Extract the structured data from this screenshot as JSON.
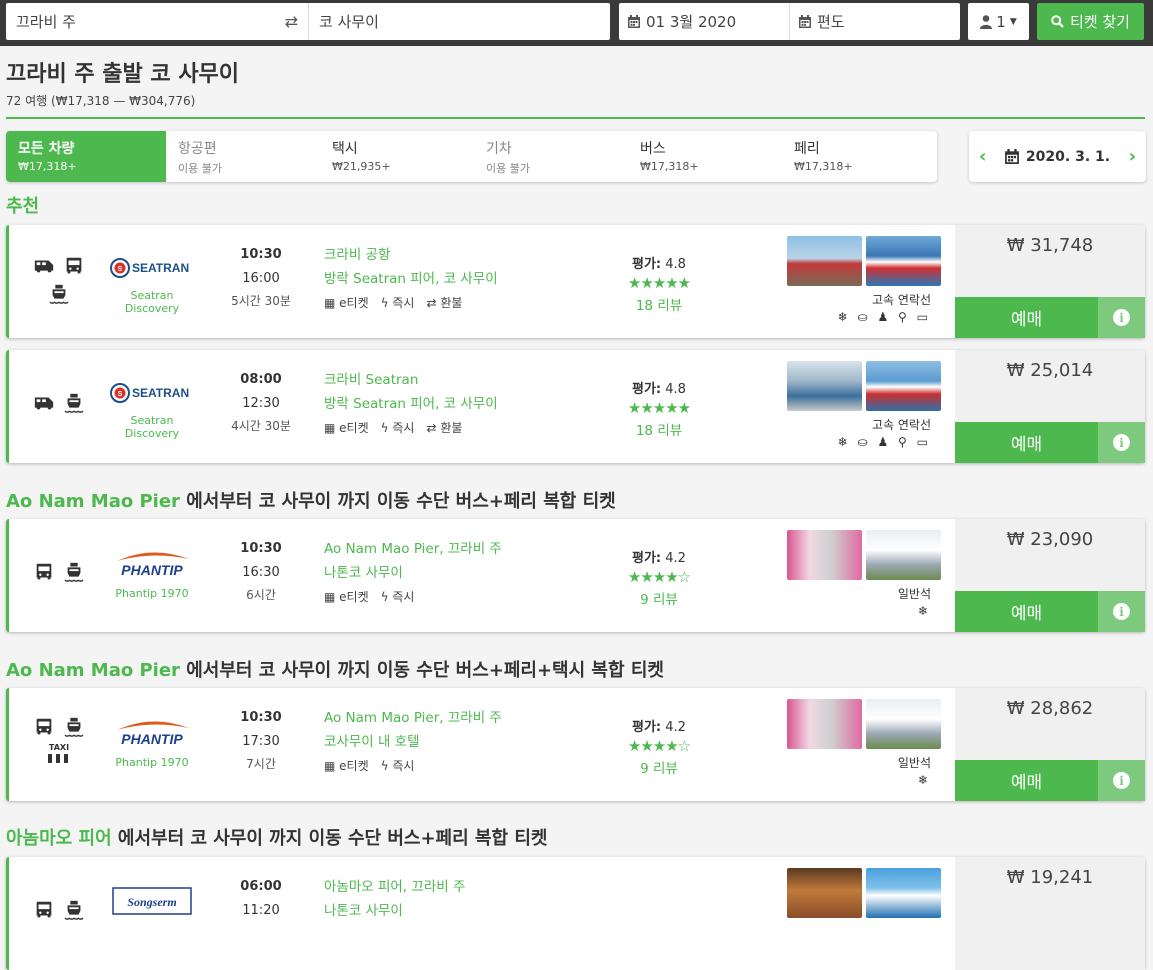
{
  "search": {
    "from": "끄라비 주",
    "to": "코 사무이",
    "date": "01 3월 2020",
    "return": "편도",
    "passengers": "1",
    "search_button": "티켓 찾기"
  },
  "header": {
    "title": "끄라비 주 출발 코 사무이",
    "subtitle": "72 여행 (₩17,318 — ₩304,776)"
  },
  "tabs": [
    {
      "label": "모든 차량",
      "sub": "₩17,318+"
    },
    {
      "label": "항공편",
      "sub": "이용 불가"
    },
    {
      "label": "택시",
      "sub": "₩21,935+"
    },
    {
      "label": "기차",
      "sub": "이용 불가"
    },
    {
      "label": "버스",
      "sub": "₩17,318+"
    },
    {
      "label": "페리",
      "sub": "₩17,318+"
    }
  ],
  "date_nav": {
    "date": "2020. 3. 1."
  },
  "sections": {
    "recommended": "추천",
    "s2_green": "Ao Nam Mao Pier",
    "s2_rest": " 에서부터 코 사무이 까지 이동 수단 버스+페리 복합 티켓",
    "s3_green": "Ao Nam Mao Pier",
    "s3_rest": " 에서부터 코 사무이 까지 이동 수단 버스+페리+택시 복합 티켓",
    "s4_green": "아놈마오 피어",
    "s4_rest": " 에서부터 코 사무이 까지 이동 수단 버스+페리 복합 티켓"
  },
  "labels": {
    "rating": "평가:",
    "book": "예매",
    "eticket": "e티켓",
    "instant": "즉시",
    "refund": "환불",
    "taxi": "TAXI"
  },
  "cards": [
    {
      "company": "Seatran Discovery",
      "logo": "SEATRAN",
      "dep": "10:30",
      "arr": "16:00",
      "dur": "5시간 30분",
      "from": "크라비 공항",
      "to": "방락 Seatran 피어, 코 사무이",
      "score": "4.8",
      "stars": "★★★★★",
      "reviews": "18 리뷰",
      "type": "고속 연락선",
      "amenities": "❄ ⛀ ♟ ⚲ ▭",
      "price": "₩ 31,748"
    },
    {
      "company": "Seatran Discovery",
      "logo": "SEATRAN",
      "dep": "08:00",
      "arr": "12:30",
      "dur": "4시간 30분",
      "from": "크라비 Seatran",
      "to": "방락 Seatran 피어, 코 사무이",
      "score": "4.8",
      "stars": "★★★★★",
      "reviews": "18 리뷰",
      "type": "고속 연락선",
      "amenities": "❄ ⛀ ♟ ⚲ ▭",
      "price": "₩ 25,014"
    },
    {
      "company": "Phantip 1970",
      "logo": "PHANTIP",
      "dep": "10:30",
      "arr": "16:30",
      "dur": "6시간",
      "from": "Ao Nam Mao Pier, 끄라비 주",
      "to": "나톤코 사무이",
      "score": "4.2",
      "stars": "★★★★☆",
      "reviews": "9 리뷰",
      "type": "일반석",
      "amenities": "❄",
      "price": "₩ 23,090"
    },
    {
      "company": "Phantip 1970",
      "logo": "PHANTIP",
      "dep": "10:30",
      "arr": "17:30",
      "dur": "7시간",
      "from": "Ao Nam Mao Pier, 끄라비 주",
      "to": "코사무이 내 호텔",
      "score": "4.2",
      "stars": "★★★★☆",
      "reviews": "9 리뷰",
      "type": "일반석",
      "amenities": "❄",
      "price": "₩ 28,862"
    },
    {
      "company": "Songserm",
      "logo": "Songserm",
      "dep": "06:00",
      "arr": "11:20",
      "from": "아놈마오 피어, 끄라비 주",
      "to": "나톤코 사무이",
      "price": "₩ 19,241"
    }
  ]
}
